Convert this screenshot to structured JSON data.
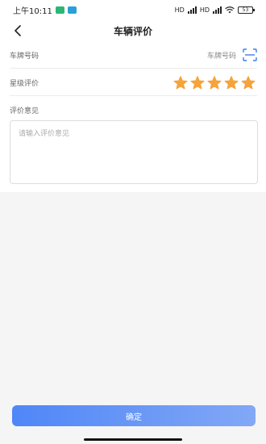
{
  "status_bar": {
    "time": "上午10:11",
    "signal_label_1": "HD",
    "signal_label_2": "HD",
    "battery": "53",
    "badge_colors": [
      "#2bb673",
      "#2a9fd8"
    ]
  },
  "nav": {
    "title": "车辆评价",
    "back_icon": "chevron-left-icon"
  },
  "form": {
    "plate_label": "车牌号码",
    "plate_placeholder": "车牌号码",
    "plate_scan_icon": "scan-icon",
    "rating_label": "星级评价",
    "rating_value": 5,
    "rating_max": 5,
    "star_color": "#f5a33b",
    "comment_label": "评价意见",
    "comment_placeholder": "请输入评价意见",
    "comment_value": ""
  },
  "actions": {
    "confirm_label": "确定",
    "accent_color": "#4f86f7"
  }
}
